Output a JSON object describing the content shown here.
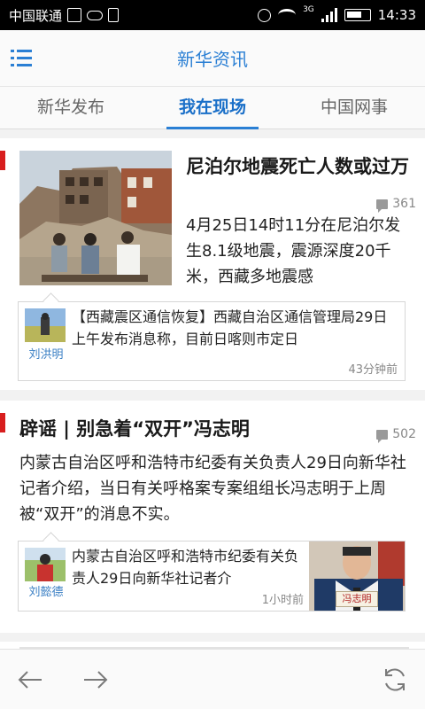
{
  "status_bar": {
    "carrier": "中国联通",
    "network": "3G",
    "time": "14:33"
  },
  "header": {
    "title": "新华资讯",
    "menu_icon": "menu-list-icon"
  },
  "tabs": [
    {
      "label": "新华发布",
      "active": false
    },
    {
      "label": "我在现场",
      "active": true
    },
    {
      "label": "中国网事",
      "active": false
    }
  ],
  "articles": [
    {
      "title": "尼泊尔地震死亡人数或过万",
      "comments": "361",
      "summary": "4月25日14时11分在尼泊尔发生8.1级地震，震源深度20千米，西藏多地震感",
      "sub_post": {
        "author": "刘洪明",
        "text": "【西藏震区通信恢复】西藏自治区通信管理局29日上午发布消息称，目前日喀则市定日",
        "time": "43分钟前"
      }
    },
    {
      "title": "辟谣 | 别急着“双开”冯志明",
      "comments": "502",
      "summary": "内蒙古自治区呼和浩特市纪委有关负责人29日向新华社记者介绍，当日有关呼格案专案组组长冯志明于上周被“双开”的消息不实。",
      "sub_post": {
        "author": "刘懿德",
        "text": "内蒙古自治区呼和浩特市纪委有关负责人29日向新华社记者介",
        "time": "1小时前",
        "photo_caption": "冯志明"
      }
    }
  ],
  "bottom_nav": {
    "back_icon": "arrow-left-icon",
    "forward_icon": "arrow-right-icon",
    "refresh_icon": "refresh-icon"
  },
  "colors": {
    "accent": "#2a7fd4",
    "marker": "#d81e1e"
  }
}
